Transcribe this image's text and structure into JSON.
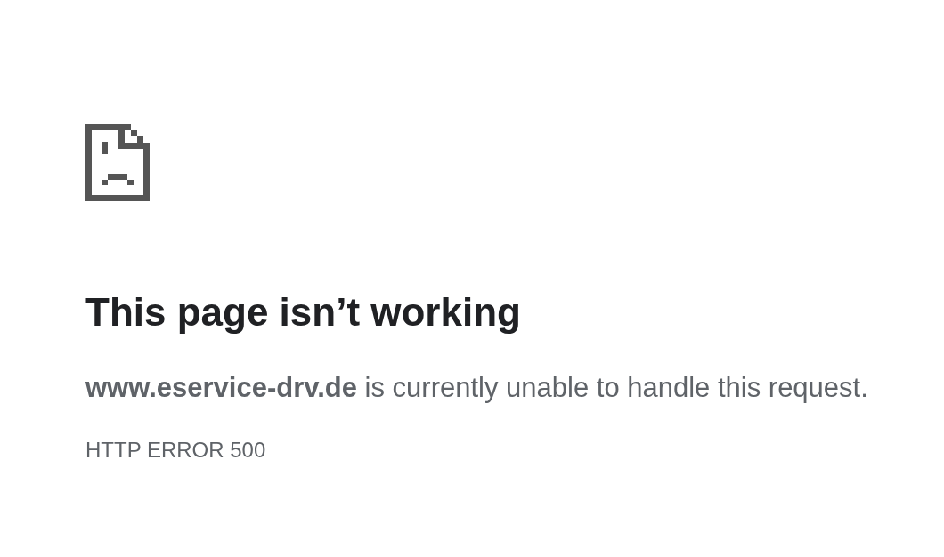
{
  "heading": "This page isn’t working",
  "message": "**www.eservice-drv.de** is currently unable to handle this request.",
  "error_code": "HTTP ERROR 500"
}
